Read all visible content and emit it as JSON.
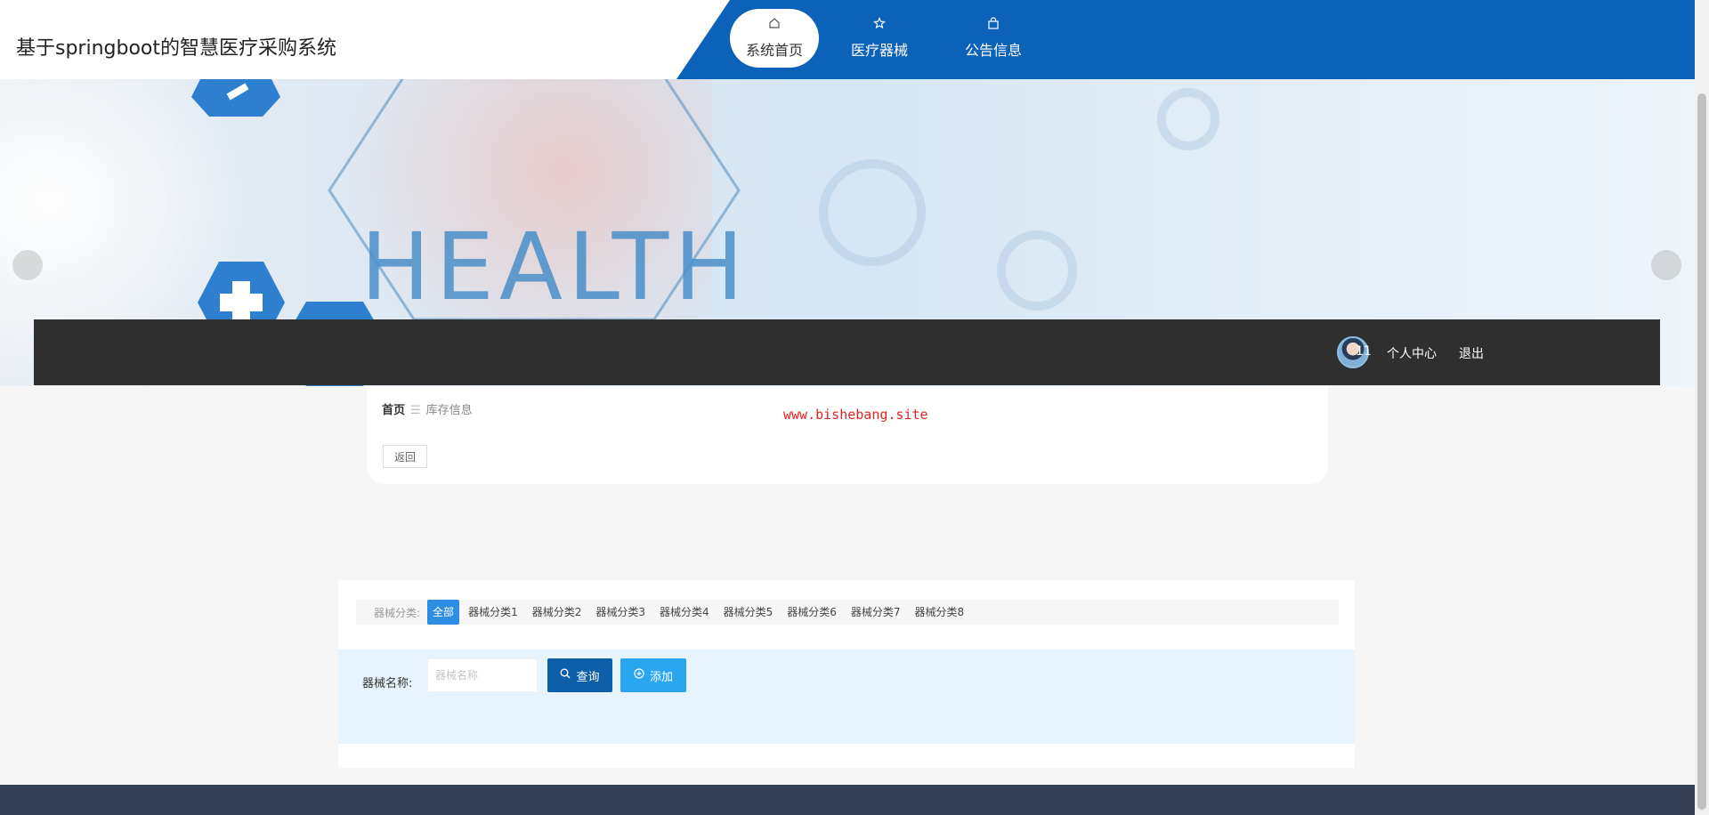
{
  "header": {
    "site_title": "基于springboot的智慧医疗采购系统",
    "nav": [
      {
        "label": "系统首页",
        "icon": "home-icon",
        "active": true
      },
      {
        "label": "医疗器械",
        "icon": "star-icon",
        "active": false
      },
      {
        "label": "公告信息",
        "icon": "bag-icon",
        "active": false
      }
    ]
  },
  "banner": {
    "image_text": "HEALTH"
  },
  "userbar": {
    "username": "11",
    "profile_label": "个人中心",
    "logout_label": "退出"
  },
  "breadcrumb": {
    "home": "首页",
    "separator": "☰",
    "current": "库存信息"
  },
  "watermark": "www.bishebang.site",
  "back_label": "返回",
  "filter": {
    "category_label": "器械分类:",
    "categories": [
      "全部",
      "器械分类1",
      "器械分类2",
      "器械分类3",
      "器械分类4",
      "器械分类5",
      "器械分类6",
      "器械分类7",
      "器械分类8"
    ],
    "active_category": "全部",
    "name_label": "器械名称:",
    "name_placeholder": "器械名称",
    "name_value": "",
    "query_label": "查询",
    "add_label": "添加"
  },
  "colors": {
    "nav_blue": "#0c62b8",
    "active_category": "#2e8ee4",
    "query_button": "#0c5fa8",
    "add_button": "#2aa6f0",
    "footer": "#333f55",
    "watermark": "#e52222"
  }
}
